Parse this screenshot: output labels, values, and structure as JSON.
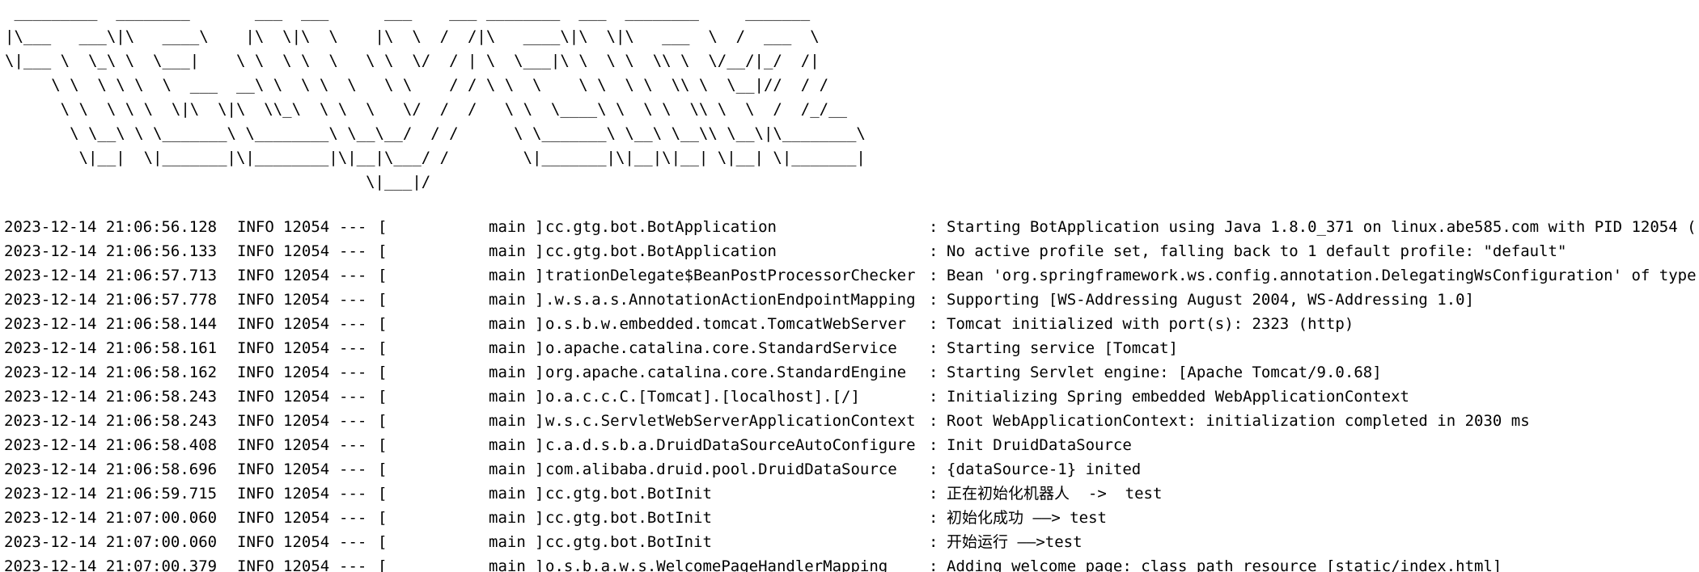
{
  "banner": {
    "lines": [
      " _________  ________       ___  ___      ___    ___ ________  ___  ________     _______",
      "|\\___   ___\\|\\   ____\\    |\\  \\|\\  \\    |\\  \\  /  /|\\   ____\\|\\  \\|\\   ___  \\  /  ___  \\",
      "\\|___ \\  \\_\\ \\  \\___|    \\ \\  \\ \\  \\   \\ \\  \\/  / | \\  \\___|\\ \\  \\ \\  \\\\ \\  \\/__/|_/  /|",
      "     \\ \\  \\ \\ \\  \\  ___  __\\ \\  \\ \\  \\   \\ \\    / / \\ \\  \\    \\ \\  \\ \\  \\\\ \\  \\__|//  / /",
      "      \\ \\  \\ \\ \\  \\|\\  \\|\\  \\\\_\\  \\ \\  \\   \\/  /  /   \\ \\  \\____\\ \\  \\ \\  \\\\ \\  \\  /  /_/__",
      "       \\ \\__\\ \\ \\_______\\ \\________\\ \\__\\__/  / /      \\ \\_______\\ \\__\\ \\__\\\\ \\__\\|\\________\\",
      "        \\|__|  \\|_______|\\|________|\\|__|\\___/ /        \\|_______|\\|__|\\|__| \\|__| \\|_______|",
      "                                       \\|___|/"
    ]
  },
  "log": {
    "level": "INFO",
    "pid": "12054",
    "separator": "---",
    "thread_open": "[",
    "thread_close": "]",
    "colon": ":",
    "lines": [
      {
        "timestamp": "2023-12-14 21:06:56.128",
        "thread": "main",
        "logger": "cc.gtg.bot.BotApplication",
        "message": "Starting BotApplication using Java 1.8.0_371 on linux.abe585.com with PID 12054 ("
      },
      {
        "timestamp": "2023-12-14 21:06:56.133",
        "thread": "main",
        "logger": "cc.gtg.bot.BotApplication",
        "message": "No active profile set, falling back to 1 default profile: \"default\""
      },
      {
        "timestamp": "2023-12-14 21:06:57.713",
        "thread": "main",
        "logger": "trationDelegate$BeanPostProcessorChecker",
        "message": "Bean 'org.springframework.ws.config.annotation.DelegatingWsConfiguration' of type"
      },
      {
        "timestamp": "2023-12-14 21:06:57.778",
        "thread": "main",
        "logger": ".w.s.a.s.AnnotationActionEndpointMapping",
        "message": "Supporting [WS-Addressing August 2004, WS-Addressing 1.0]"
      },
      {
        "timestamp": "2023-12-14 21:06:58.144",
        "thread": "main",
        "logger": "o.s.b.w.embedded.tomcat.TomcatWebServer",
        "message": "Tomcat initialized with port(s): 2323 (http)"
      },
      {
        "timestamp": "2023-12-14 21:06:58.161",
        "thread": "main",
        "logger": "o.apache.catalina.core.StandardService",
        "message": "Starting service [Tomcat]"
      },
      {
        "timestamp": "2023-12-14 21:06:58.162",
        "thread": "main",
        "logger": "org.apache.catalina.core.StandardEngine",
        "message": "Starting Servlet engine: [Apache Tomcat/9.0.68]"
      },
      {
        "timestamp": "2023-12-14 21:06:58.243",
        "thread": "main",
        "logger": "o.a.c.c.C.[Tomcat].[localhost].[/]",
        "message": "Initializing Spring embedded WebApplicationContext"
      },
      {
        "timestamp": "2023-12-14 21:06:58.243",
        "thread": "main",
        "logger": "w.s.c.ServletWebServerApplicationContext",
        "message": "Root WebApplicationContext: initialization completed in 2030 ms"
      },
      {
        "timestamp": "2023-12-14 21:06:58.408",
        "thread": "main",
        "logger": "c.a.d.s.b.a.DruidDataSourceAutoConfigure",
        "message": "Init DruidDataSource"
      },
      {
        "timestamp": "2023-12-14 21:06:58.696",
        "thread": "main",
        "logger": "com.alibaba.druid.pool.DruidDataSource",
        "message": "{dataSource-1} inited"
      },
      {
        "timestamp": "2023-12-14 21:06:59.715",
        "thread": "main",
        "logger": "cc.gtg.bot.BotInit",
        "message": "正在初始化机器人  ->  test"
      },
      {
        "timestamp": "2023-12-14 21:07:00.060",
        "thread": "main",
        "logger": "cc.gtg.bot.BotInit",
        "message": "初始化成功 ——> test"
      },
      {
        "timestamp": "2023-12-14 21:07:00.060",
        "thread": "main",
        "logger": "cc.gtg.bot.BotInit",
        "message": "开始运行 ——>test"
      },
      {
        "timestamp": "2023-12-14 21:07:00.379",
        "thread": "main",
        "logger": "o.s.b.a.w.s.WelcomePageHandlerMapping",
        "message": "Adding welcome page: class path resource [static/index.html]"
      }
    ]
  }
}
